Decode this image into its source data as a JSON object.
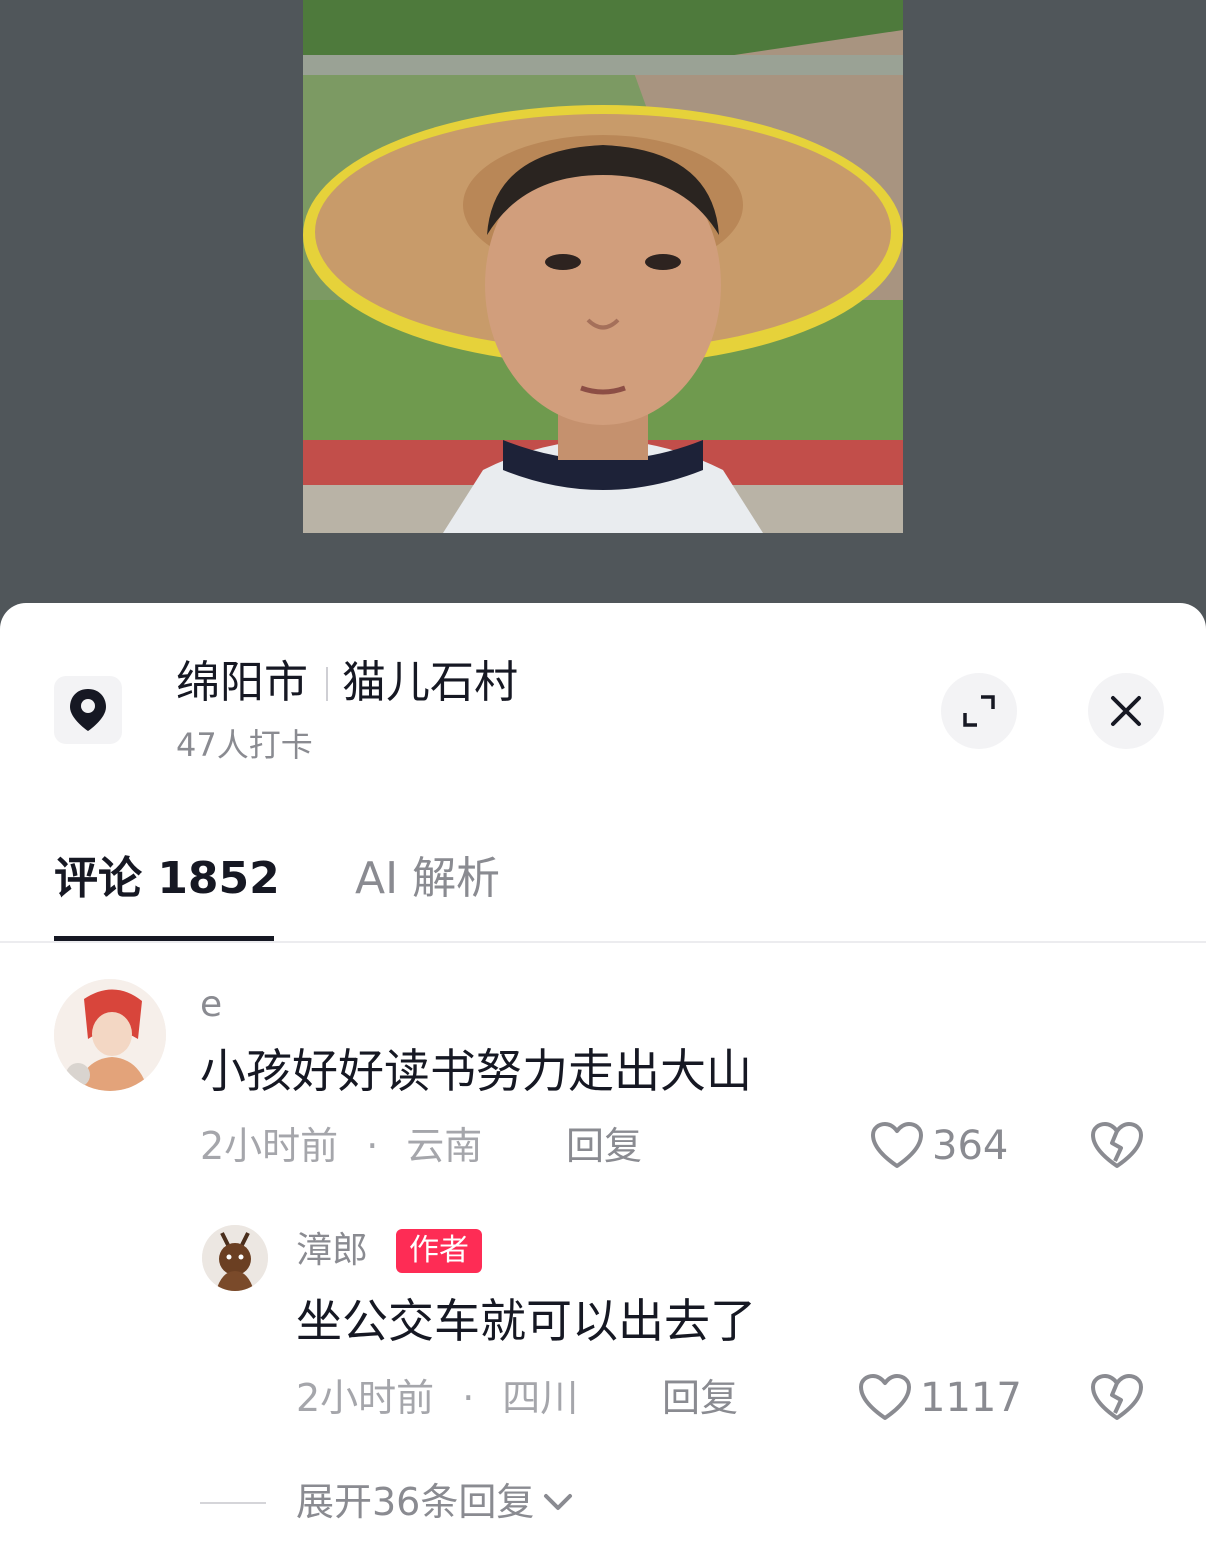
{
  "location": {
    "city": "绵阳市",
    "village": "猫儿石村",
    "checkins": "47人打卡"
  },
  "tabs": {
    "comments": "评论 1852",
    "ai": "AI 解析"
  },
  "comments": [
    {
      "username": "e",
      "text": "小孩好好读书努力走出大山",
      "time": "2小时前",
      "region": "云南",
      "reply_label": "回复",
      "likes": "364"
    }
  ],
  "replies": [
    {
      "username": "漳郎",
      "badge": "作者",
      "text": "坐公交车就可以出去了",
      "time": "2小时前",
      "region": "四川",
      "reply_label": "回复",
      "likes": "1117"
    }
  ],
  "expand_replies": "展开36条回复",
  "separator": "·",
  "icons": {
    "location": "location-pin-icon",
    "expand": "expand-icon",
    "close": "close-icon",
    "like": "heart-outline-icon",
    "dislike": "broken-heart-icon",
    "chevron": "chevron-down-icon"
  },
  "colors": {
    "accent": "#fe2c55",
    "text": "#161823",
    "muted": "#8a8b91"
  }
}
